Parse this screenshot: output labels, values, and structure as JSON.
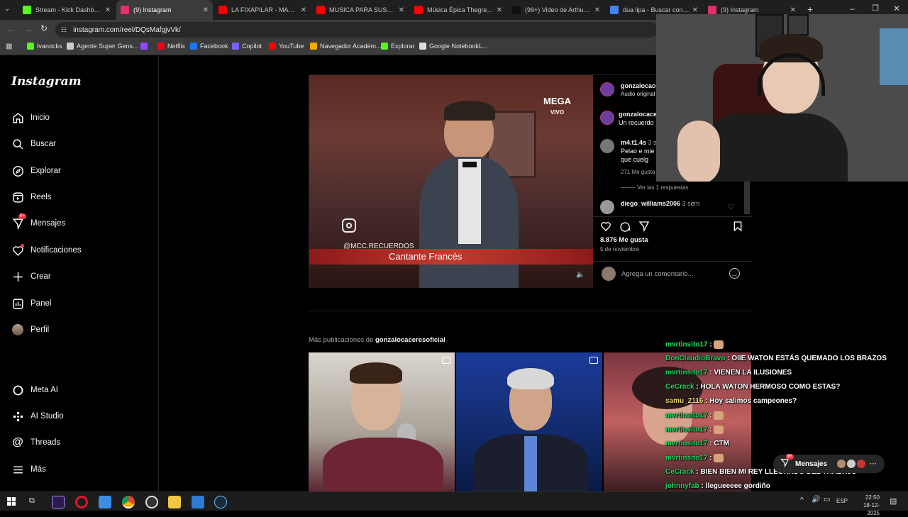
{
  "browser": {
    "tabs": [
      {
        "title": "Stream - Kick Dashboard",
        "icon": "kick-icon",
        "color": "#53fc18"
      },
      {
        "title": "(9) Instagram",
        "icon": "instagram-icon",
        "color": "#e1306c",
        "active": true
      },
      {
        "title": "LA FIXAPILAR - MAMBITO",
        "icon": "youtube-icon",
        "color": "#ff0000"
      },
      {
        "title": "MUSICA PARA SUSPENSO",
        "icon": "youtube-icon",
        "color": "#ff0000"
      },
      {
        "title": "Música Épica Thegrefg - Y",
        "icon": "youtube-icon",
        "color": "#ff0000"
      },
      {
        "title": "(99+) Video de Arthur Lim",
        "icon": "tiktok-icon",
        "color": "#111111"
      },
      {
        "title": "dua lipa - Buscar con Goo",
        "icon": "google-icon",
        "color": "#4285f4"
      },
      {
        "title": "(9) Instagram",
        "icon": "instagram-icon",
        "color": "#e1306c"
      }
    ],
    "url": "instagram.com/reel/DQsMafgjvVk/",
    "bookmarks": [
      {
        "label": "Ivanocks",
        "color": "#53fc18"
      },
      {
        "label": "Agente Super Gens...",
        "color": "#cccccc"
      },
      {
        "label": "",
        "color": "#9146ff"
      },
      {
        "label": "Netflix",
        "color": "#e50914"
      },
      {
        "label": "Facebook",
        "color": "#1877f2"
      },
      {
        "label": "Copilot",
        "color": "#7b61ff"
      },
      {
        "label": "YouTube",
        "color": "#ff0000"
      },
      {
        "label": "Navegador Académ...",
        "color": "#f2a900"
      },
      {
        "label": "Explorar",
        "color": "#53fc18"
      },
      {
        "label": "Google NotebookL...",
        "color": "#dddddd"
      }
    ]
  },
  "instagram": {
    "logo": "Instagram",
    "nav": {
      "home": "Inicio",
      "search": "Buscar",
      "explore": "Explorar",
      "reels": "Reels",
      "messages": "Mensajes",
      "messages_badge": "9+",
      "notifications": "Notificaciones",
      "create": "Crear",
      "panel": "Panel",
      "profile": "Perfil",
      "meta_ai": "Meta AI",
      "ai_studio": "AI Studio",
      "threads": "Threads",
      "more": "Más"
    },
    "video": {
      "overlay_channel": "MEGA",
      "overlay_live": "VIVO",
      "handle": "@MCC.RECUERDOS",
      "caption": "Cantante Francés"
    },
    "post": {
      "author": "gonzalocace",
      "audio": "Audio original",
      "caption_author": "gonzalocace",
      "caption_text": "Un recuerdo",
      "comment1_user": "m4.t1.4s",
      "comment1_time": "3 se",
      "comment1_text_line1": "Pelao e mie",
      "comment1_text_line2": "que cuelg",
      "comment1_likes": "271 Me gusta",
      "view_replies": "Ver las 1 respuestas",
      "comment2_user": "diego_williams2006",
      "comment2_time": "3 sem",
      "likes": "8.876 Me gusta",
      "date": "5 de noviembre",
      "comment_placeholder": "Agrega un comentario..."
    },
    "more_label": "Más publicaciones de",
    "more_user": "gonzalocaceresoficial"
  },
  "chat": [
    {
      "user": "mvrtinsito17",
      "text": "",
      "color": "#1ed760"
    },
    {
      "user": "DonClaudioBravo",
      "text": "OIIE WATON ESTÁS QUEMADO LOS BRAZOS",
      "color": "#1ed760"
    },
    {
      "user": "mvrtinsito17",
      "text": "VIENEN LA ILUSIONES",
      "color": "#1ed760"
    },
    {
      "user": "CeCrack",
      "text": "HOLA WATON HERMOSO COMO ESTAS?",
      "color": "#1ed760"
    },
    {
      "user": "samu_2116",
      "text": "Hoy salimos campeones?",
      "color": "#e0d56e"
    },
    {
      "user": "mvrtinsito17",
      "text": "",
      "color": "#1ed760"
    },
    {
      "user": "mvrtinsito17",
      "text": "",
      "color": "#1ed760"
    },
    {
      "user": "mvrtinsito17",
      "text": "CTM",
      "color": "#1ed760"
    },
    {
      "user": "mvrtinsito17",
      "text": "",
      "color": "#1ed760"
    },
    {
      "user": "CeCrack",
      "text": "BIEN BIEN MI REY LLEGANDO DEL TRABAJO",
      "color": "#1ed760"
    },
    {
      "user": "johnnyfab",
      "text": "llegueeeee gordiño",
      "color": "#1ed760"
    },
    {
      "user": "mvrtinsito17",
      "text": "",
      "color": "#1ed760"
    }
  ],
  "messages_pill": {
    "label": "Mensajes",
    "badge": "9+"
  },
  "taskbar": {
    "language": "ESP",
    "time": "22:50",
    "date": "18-12-2025"
  }
}
